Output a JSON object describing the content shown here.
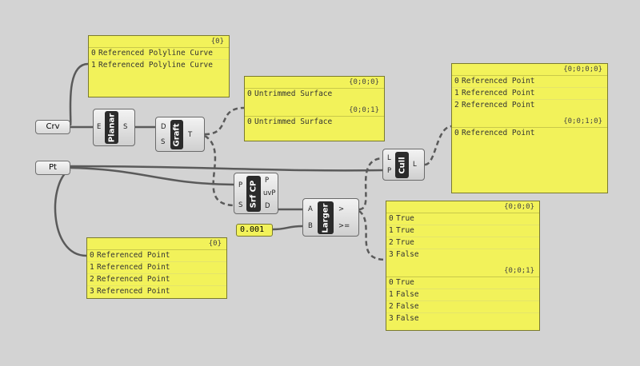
{
  "params": {
    "crv": {
      "label": "Crv"
    },
    "pt": {
      "label": "Pt"
    },
    "tolerance": {
      "value": "0.001"
    }
  },
  "components": {
    "planar": {
      "name": "Planar",
      "inputs": [
        "E"
      ],
      "outputs": [
        "S"
      ]
    },
    "graft": {
      "name": "Graft",
      "inputs": [
        "D",
        "S"
      ],
      "outputs": [
        "T"
      ]
    },
    "srfcp": {
      "name": "Srf CP",
      "inputs": [
        "P",
        "S"
      ],
      "outputs": [
        "P",
        "uvP",
        "D"
      ]
    },
    "larger": {
      "name": "Larger",
      "inputs": [
        "A",
        "B"
      ],
      "outputs": [
        ">",
        ">="
      ]
    },
    "cull": {
      "name": "Cull",
      "inputs": [
        "L",
        "P"
      ],
      "outputs": [
        "L"
      ]
    }
  },
  "panels": {
    "polyline": {
      "branches": [
        {
          "path": "{0}",
          "items": [
            {
              "i": "0",
              "text": "Referenced Polyline Curve"
            },
            {
              "i": "1",
              "text": "Referenced Polyline Curve"
            }
          ]
        }
      ]
    },
    "surfaces": {
      "branches": [
        {
          "path": "{0;0;0}",
          "items": [
            {
              "i": "0",
              "text": "Untrimmed Surface"
            }
          ]
        },
        {
          "path": "{0;0;1}",
          "items": [
            {
              "i": "0",
              "text": "Untrimmed Surface"
            }
          ]
        }
      ]
    },
    "culled": {
      "branches": [
        {
          "path": "{0;0;0;0}",
          "items": [
            {
              "i": "0",
              "text": "Referenced Point"
            },
            {
              "i": "1",
              "text": "Referenced Point"
            },
            {
              "i": "2",
              "text": "Referenced Point"
            }
          ]
        },
        {
          "path": "{0;0;1;0}",
          "items": [
            {
              "i": "0",
              "text": "Referenced Point"
            }
          ]
        }
      ]
    },
    "points": {
      "branches": [
        {
          "path": "{0}",
          "items": [
            {
              "i": "0",
              "text": "Referenced Point"
            },
            {
              "i": "1",
              "text": "Referenced Point"
            },
            {
              "i": "2",
              "text": "Referenced Point"
            },
            {
              "i": "3",
              "text": "Referenced Point"
            }
          ]
        }
      ]
    },
    "booleans": {
      "branches": [
        {
          "path": "{0;0;0}",
          "items": [
            {
              "i": "0",
              "text": "True"
            },
            {
              "i": "1",
              "text": "True"
            },
            {
              "i": "2",
              "text": "True"
            },
            {
              "i": "3",
              "text": "False"
            }
          ]
        },
        {
          "path": "{0;0;1}",
          "items": [
            {
              "i": "0",
              "text": "True"
            },
            {
              "i": "1",
              "text": "False"
            },
            {
              "i": "2",
              "text": "False"
            },
            {
              "i": "3",
              "text": "False"
            }
          ]
        }
      ]
    }
  },
  "colors": {
    "canvas": "#d3d3d3",
    "panel": "#f2f25a",
    "wire": "#5a5a5a",
    "bar": "#2b2b2b"
  }
}
